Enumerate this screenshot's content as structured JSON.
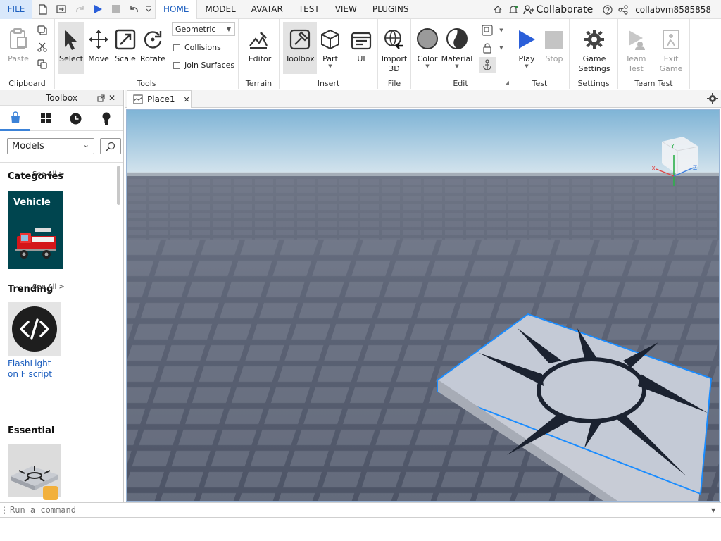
{
  "menubar": {
    "file": "FILE",
    "tabs": [
      "HOME",
      "MODEL",
      "AVATAR",
      "TEST",
      "VIEW",
      "PLUGINS"
    ],
    "active_tab": "HOME",
    "collaborate": "Collaborate",
    "username": "collabvm8585858"
  },
  "ribbon": {
    "clipboard": {
      "title": "Clipboard",
      "paste": "Paste"
    },
    "tools": {
      "title": "Tools",
      "select": "Select",
      "move": "Move",
      "scale": "Scale",
      "rotate": "Rotate",
      "geometry_mode": "Geometric",
      "collisions": "Collisions",
      "join_surfaces": "Join Surfaces"
    },
    "terrain": {
      "title": "Terrain",
      "editor": "Editor"
    },
    "insert": {
      "title": "Insert",
      "toolbox": "Toolbox",
      "part": "Part",
      "ui": "UI"
    },
    "file": {
      "title": "File",
      "import_line1": "Import",
      "import_line2": "3D"
    },
    "edit": {
      "title": "Edit",
      "color": "Color",
      "material": "Material"
    },
    "test": {
      "title": "Test",
      "play": "Play",
      "stop": "Stop"
    },
    "settings": {
      "title": "Settings",
      "game_line1": "Game",
      "game_line2": "Settings"
    },
    "team_test": {
      "title": "Team Test",
      "team_line1": "Team",
      "team_line2": "Test",
      "exit_line1": "Exit",
      "exit_line2": "Game"
    }
  },
  "toolbox": {
    "title": "Toolbox",
    "category_select": "Models",
    "sections": {
      "categories": {
        "title": "Categories",
        "see_all": "See All >",
        "item": "Vehicle"
      },
      "trending": {
        "title": "Trending",
        "see_all": "See All >",
        "item_line1": "FlashLight",
        "item_line2": "on F script"
      },
      "essential": {
        "title": "Essential"
      }
    }
  },
  "document": {
    "tab_name": "Place1"
  },
  "command_bar": {
    "placeholder": "Run a command"
  },
  "colors": {
    "accent": "#1d5fbf",
    "selection": "#1a8cff",
    "play": "#2b5fd9"
  }
}
